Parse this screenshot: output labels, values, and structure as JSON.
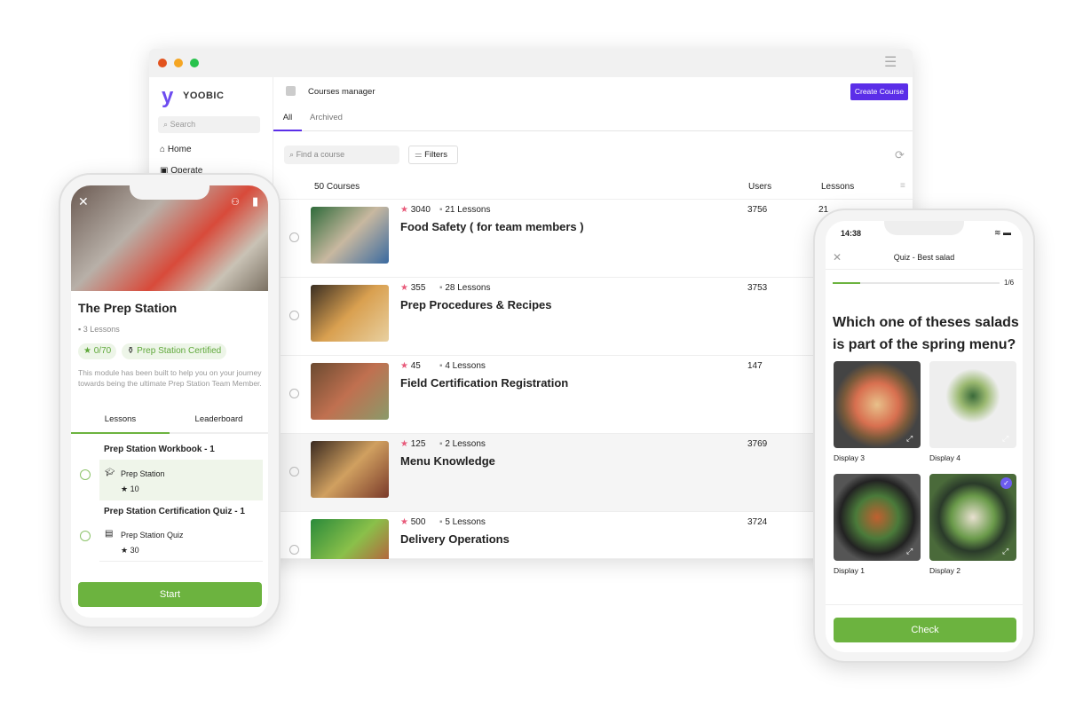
{
  "desktop": {
    "brand": "YOOBIC",
    "sidebar": {
      "search_placeholder": "Search",
      "items": [
        {
          "label": "Home",
          "icon": "home-icon"
        },
        {
          "label": "Operate",
          "icon": "briefcase-icon"
        }
      ]
    },
    "header": {
      "title": "Courses manager",
      "create_button": "Create Course"
    },
    "tabs": [
      "All",
      "Archived"
    ],
    "toolbar": {
      "find_placeholder": "Find a course",
      "filters": "Filters"
    },
    "table": {
      "count": "50 Courses",
      "col_users": "Users",
      "col_lessons": "Lessons",
      "rows": [
        {
          "rating": "3040",
          "lessons": "21 Lessons",
          "title": "Food Safety ( for team members )",
          "users": "3756",
          "lessons_col": "21"
        },
        {
          "rating": "355",
          "lessons": "28 Lessons",
          "title": "Prep Procedures & Recipes",
          "users": "3753",
          "lessons_col": ""
        },
        {
          "rating": "45",
          "lessons": "4 Lessons",
          "title": "Field Certification Registration",
          "users": "147",
          "lessons_col": ""
        },
        {
          "rating": "125",
          "lessons": "2 Lessons",
          "title": "Menu Knowledge",
          "users": "3769",
          "lessons_col": ""
        },
        {
          "rating": "500",
          "lessons": "5 Lessons",
          "title": "Delivery Operations",
          "users": "3724",
          "lessons_col": ""
        }
      ]
    },
    "accent": "#5b2ee8"
  },
  "left_phone": {
    "title": "The Prep Station",
    "lessons": "3 Lessons",
    "points": "0/70",
    "badge": "Prep Station Certified",
    "description": "This module has been built to help you on your journey towards being the ultimate Prep Station Team Member.",
    "tabs": [
      "Lessons",
      "Leaderboard"
    ],
    "sections": [
      {
        "heading": "Prep Station Workbook - 1",
        "item": "Prep Station",
        "points": "10",
        "icon": "graduation-cap-icon"
      },
      {
        "heading": "Prep Station Certification Quiz - 1",
        "item": "Prep Station Quiz",
        "points": "30",
        "icon": "clipboard-icon"
      }
    ],
    "start": "Start",
    "accent": "#6cb33f"
  },
  "right_phone": {
    "time": "14:38",
    "title": "Quiz - Best salad",
    "progress_label": "1/6",
    "progress": 0.167,
    "question": "Which one of theses salads is part of the spring menu?",
    "options": [
      {
        "label": "Display 3"
      },
      {
        "label": "Display 4"
      },
      {
        "label": "Display 1"
      },
      {
        "label": "Display 2",
        "selected": true
      }
    ],
    "check": "Check"
  }
}
